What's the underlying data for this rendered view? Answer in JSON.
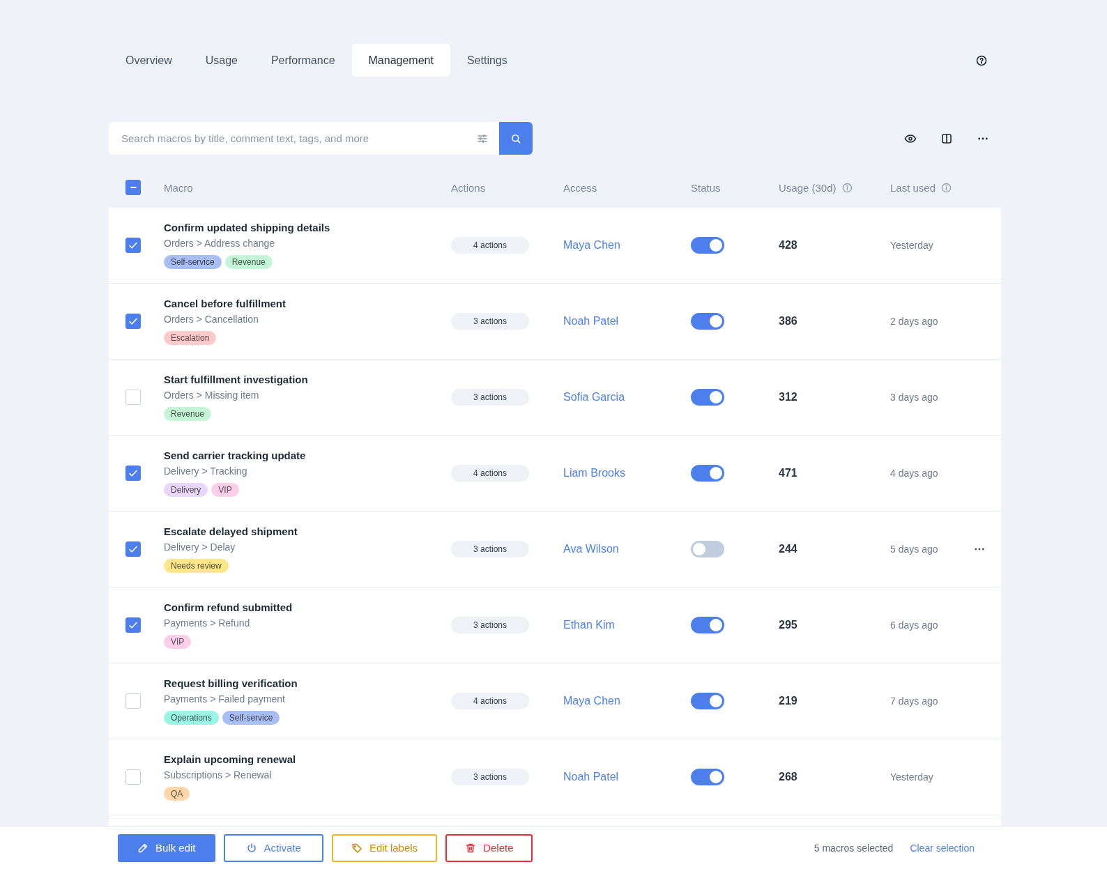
{
  "tabs": [
    {
      "label": "Overview",
      "selected": false
    },
    {
      "label": "Usage",
      "selected": false
    },
    {
      "label": "Performance",
      "selected": false
    },
    {
      "label": "Management",
      "selected": true
    },
    {
      "label": "Settings",
      "selected": false
    }
  ],
  "search": {
    "placeholder": "Search macros by title, comment text, tags, and more"
  },
  "table": {
    "select_all": {
      "checked": true,
      "indeterminate": true
    },
    "columns": [
      {
        "label": "Macro",
        "info": false
      },
      {
        "label": "Actions",
        "info": false
      },
      {
        "label": "Access",
        "info": false
      },
      {
        "label": "Status",
        "info": false
      },
      {
        "label": "Usage (30d)",
        "info": true
      },
      {
        "label": "Last used",
        "info": true
      }
    ],
    "rows": [
      {
        "selected": true,
        "title": "Confirm updated shipping details",
        "path": "Orders > Address change",
        "tags": [
          {
            "label": "Self-service",
            "color": "#a9bdf5"
          },
          {
            "label": "Revenue",
            "color": "#c4f5d6"
          }
        ],
        "actions": "4 actions",
        "access": "Maya Chen",
        "on": true,
        "usage": "428",
        "last_used": "Yesterday",
        "menu": false
      },
      {
        "selected": true,
        "title": "Cancel before fulfillment",
        "path": "Orders > Cancellation",
        "tags": [
          {
            "label": "Escalation",
            "color": "#fecaca"
          }
        ],
        "actions": "3 actions",
        "access": "Noah Patel",
        "on": true,
        "usage": "386",
        "last_used": "2 days ago",
        "menu": false
      },
      {
        "selected": false,
        "title": "Start fulfillment investigation",
        "path": "Orders > Missing item",
        "tags": [
          {
            "label": "Revenue",
            "color": "#c4f5d6"
          }
        ],
        "actions": "3 actions",
        "access": "Sofia Garcia",
        "on": true,
        "usage": "312",
        "last_used": "3 days ago",
        "menu": false
      },
      {
        "selected": true,
        "title": "Send carrier tracking update",
        "path": "Delivery > Tracking",
        "tags": [
          {
            "label": "Delivery",
            "color": "#ead5fb"
          },
          {
            "label": "VIP",
            "color": "#fbcfe8"
          }
        ],
        "actions": "4 actions",
        "access": "Liam Brooks",
        "on": true,
        "usage": "471",
        "last_used": "4 days ago",
        "menu": false
      },
      {
        "selected": true,
        "title": "Escalate delayed shipment",
        "path": "Delivery > Delay",
        "tags": [
          {
            "label": "Needs review",
            "color": "#fde68a"
          }
        ],
        "actions": "3 actions",
        "access": "Ava Wilson",
        "on": false,
        "usage": "244",
        "last_used": "5 days ago",
        "menu": true
      },
      {
        "selected": true,
        "title": "Confirm refund submitted",
        "path": "Payments > Refund",
        "tags": [
          {
            "label": "VIP",
            "color": "#fbcfe8"
          }
        ],
        "actions": "3 actions",
        "access": "Ethan Kim",
        "on": true,
        "usage": "295",
        "last_used": "6 days ago",
        "menu": false
      },
      {
        "selected": false,
        "title": "Request billing verification",
        "path": "Payments > Failed payment",
        "tags": [
          {
            "label": "Operations",
            "color": "#99f6e4"
          },
          {
            "label": "Self-service",
            "color": "#a9bdf5"
          }
        ],
        "actions": "4 actions",
        "access": "Maya Chen",
        "on": true,
        "usage": "219",
        "last_used": "7 days ago",
        "menu": false
      },
      {
        "selected": false,
        "title": "Explain upcoming renewal",
        "path": "Subscriptions > Renewal",
        "tags": [
          {
            "label": "QA",
            "color": "#fed7aa"
          }
        ],
        "actions": "3 actions",
        "access": "Noah Patel",
        "on": true,
        "usage": "268",
        "last_used": "Yesterday",
        "menu": false
      }
    ]
  },
  "footer": {
    "buttons": [
      {
        "label": "Bulk edit",
        "kind": "edit"
      },
      {
        "label": "Activate",
        "kind": "activate"
      },
      {
        "label": "Edit labels",
        "kind": "labels"
      },
      {
        "label": "Delete",
        "kind": "delete"
      }
    ],
    "selection_count": "5 macros selected",
    "clear_link": "Clear selection"
  }
}
